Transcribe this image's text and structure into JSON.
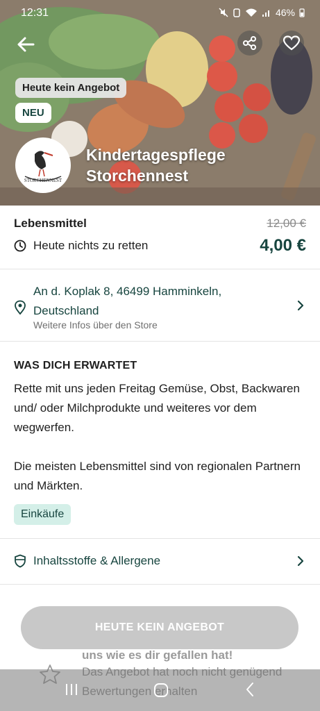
{
  "status_bar": {
    "time": "12:31",
    "battery": "46%"
  },
  "hero": {
    "badge_no_offer": "Heute kein Angebot",
    "badge_new": "NEU",
    "store_name_line1": "Kindertagespflege",
    "store_name_line2": "Storchennest",
    "logo_text": "STORCHENNEST"
  },
  "offer": {
    "category": "Lebensmittel",
    "original_price": "12,00 €",
    "price": "4,00 €",
    "pickup_status": "Heute nichts zu retten"
  },
  "address": {
    "line1": "An d. Koplak 8, 46499 Hamminkeln,",
    "line2": "Deutschland",
    "more_info": "Weitere Infos über den Store"
  },
  "description": {
    "title": "WAS DICH ERWARTET",
    "paragraph1": "Rette mit uns jeden Freitag Gemüse, Obst, Backwaren und/ oder Milchprodukte und weiteres vor dem wegwerfen.",
    "paragraph2": "Die meisten Lebensmittel sind von regionalen Partnern und Märkten.",
    "tag": "Einkäufe"
  },
  "allergens": {
    "label": "Inhaltsstoffe & Allergene"
  },
  "cta": {
    "label": "HEUTE KEIN ANGEBOT"
  },
  "rating": {
    "title": "uns wie es dir gefallen hat!",
    "desc": "Das Angebot hat noch nicht genügend Bewertungen erhalten"
  },
  "colors": {
    "brand": "#17453f",
    "tag_bg": "#d4efe8",
    "cta_disabled": "#c8c8c8"
  },
  "icons": [
    "back-icon",
    "share-icon",
    "heart-icon",
    "clock-icon",
    "location-pin-icon",
    "chevron-right-icon",
    "shield-icon",
    "star-icon"
  ]
}
